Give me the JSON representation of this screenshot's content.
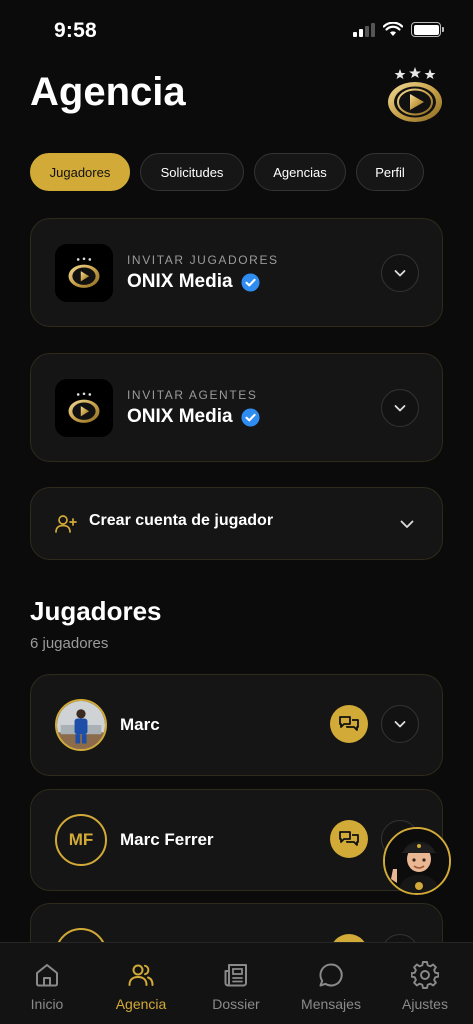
{
  "status": {
    "time": "9:58"
  },
  "header": {
    "title": "Agencia",
    "logo_icon": "onix-media-logo"
  },
  "tabs": [
    {
      "label": "Jugadores",
      "active": true
    },
    {
      "label": "Solicitudes",
      "active": false
    },
    {
      "label": "Agencias",
      "active": false
    },
    {
      "label": "Perfil",
      "active": false
    }
  ],
  "invites": [
    {
      "kicker": "INVITAR JUGADORES",
      "name": "ONIX Media",
      "verified": true
    },
    {
      "kicker": "INVITAR AGENTES",
      "name": "ONIX Media",
      "verified": true
    }
  ],
  "create_account": {
    "label": "Crear cuenta de jugador",
    "icon": "user-plus-icon"
  },
  "players_section": {
    "title": "Jugadores",
    "count": "6 jugadores"
  },
  "players": [
    {
      "name": "Marc",
      "avatar": "photo"
    },
    {
      "name": "Marc Ferrer",
      "initials": "MF"
    },
    {
      "name": "",
      "initials": ""
    }
  ],
  "nav": [
    {
      "label": "Inicio",
      "icon": "home-icon",
      "active": false
    },
    {
      "label": "Agencia",
      "icon": "users-icon",
      "active": true
    },
    {
      "label": "Dossier",
      "icon": "newspaper-icon",
      "active": false
    },
    {
      "label": "Mensajes",
      "icon": "chat-bubble-icon",
      "active": false
    },
    {
      "label": "Ajustes",
      "icon": "gear-icon",
      "active": false
    }
  ],
  "colors": {
    "accent": "#d2aa37",
    "background": "#0b0b0b",
    "card": "#151515",
    "verified": "#2f8cf0"
  }
}
